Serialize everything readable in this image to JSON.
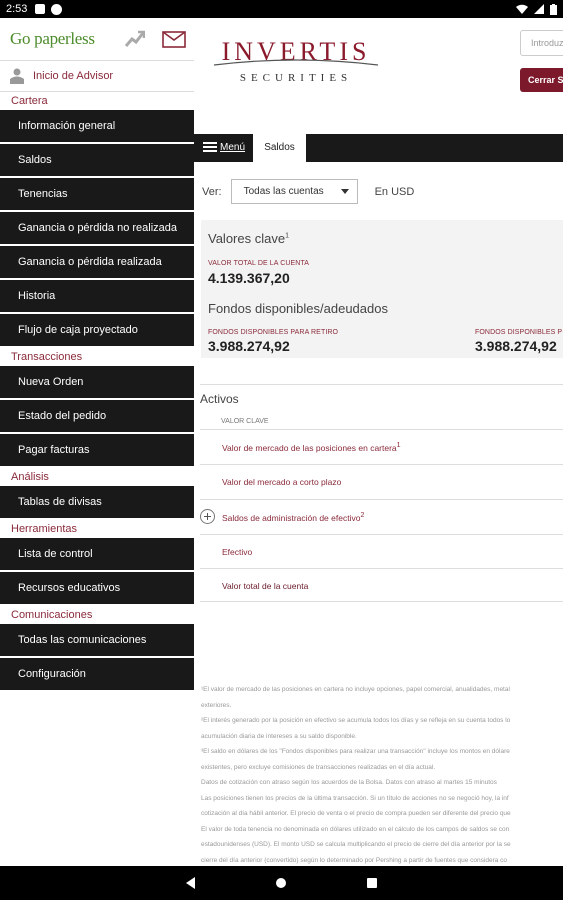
{
  "status_bar": {
    "time": "2:53"
  },
  "sidebar": {
    "logo": "Go paperless",
    "advisor_link": "Inicio de Advisor",
    "sections": [
      {
        "title": "Cartera",
        "items": [
          "Información general",
          "Saldos",
          "Tenencias",
          "Ganancia o pérdida no realizada",
          "Ganancia o pérdida realizada",
          "Historia",
          "Flujo de caja proyectado"
        ]
      },
      {
        "title": "Transacciones",
        "items": [
          "Nueva Orden",
          "Estado del pedido",
          "Pagar facturas"
        ]
      },
      {
        "title": "Análisis",
        "items": [
          "Tablas de divisas"
        ]
      },
      {
        "title": "Herramientas",
        "items": [
          "Lista de control",
          "Recursos educativos"
        ]
      },
      {
        "title": "Comunicaciones",
        "items": [
          "Todas las comunicaciones",
          "Configuración"
        ]
      }
    ]
  },
  "header": {
    "brand_line1": "INVERTIS",
    "brand_line2": "SECURITIES",
    "search_placeholder": "Introduz",
    "logout_label": "Cerrar Se"
  },
  "tabbar": {
    "menu_label": "Menú",
    "active_tab": "Saldos"
  },
  "filters": {
    "view_label": "Ver:",
    "account_select": "Todas las cuentas",
    "currency_note": "En USD"
  },
  "key_values": {
    "title": "Valores clave",
    "title_sup": "1",
    "total_label": "VALOR TOTAL DE LA CUENTA",
    "total_value": "4.139.367,20",
    "funds_title": "Fondos disponibles/adeudados",
    "funds_label_1": "FONDOS DISPONIBLES PARA RETIRO",
    "funds_value_1": "3.988.274,92",
    "funds_label_2": "FONDOS DISPONIBLES P",
    "funds_value_2": "3.988.274,92"
  },
  "activos": {
    "title": "Activos",
    "column_header": "VALOR CLAVE",
    "rows": [
      {
        "label": "Valor de mercado de las posiciones en cartera",
        "sup": "1"
      },
      {
        "label": "Valor del mercado a corto plazo",
        "sup": ""
      },
      {
        "label": "Saldos de administración de efectivo",
        "sup": "2"
      },
      {
        "label": "Efectivo",
        "sup": ""
      },
      {
        "label": "Valor total de la cuenta",
        "sup": ""
      }
    ]
  },
  "footnotes": [
    "¹El valor de mercado de las posiciones en cartera no incluye opciones, papel comercial, anualidades, metal",
    "exteriores.",
    "²El interés generado por la posición en efectivo se acumula todos los días y se refleja en su cuenta todos lo",
    "acumulación diaria de intereses a su saldo disponible.",
    "³El saldo en dólares de los \"Fondos disponibles para realizar una transacción\" incluye los montos en dólare",
    "existentes, pero excluye comisiones de transacciones realizadas en el día actual.",
    "Datos de cotización con atraso según los acuerdos de la Bolsa. Datos con atraso al martes 15 minutos",
    "Las posiciones tienen los precios de la última transacción. Si un título de acciones no se negoció hoy, la inf",
    "cotización al día hábil anterior. El precio de venta o el precio de compra pueden ser diferente del precio que",
    "El valor de toda tenencia no denominada en dólares utilizado en el cálculo de los campos de saldos se con",
    "estadounidenses (USD). El monto USD se calcula multiplicando el precio de cierre del día anterior por la se",
    "cierre del día anterior (convertido) según lo determinado por Pershing a partir de fuentes que considera co"
  ]
}
